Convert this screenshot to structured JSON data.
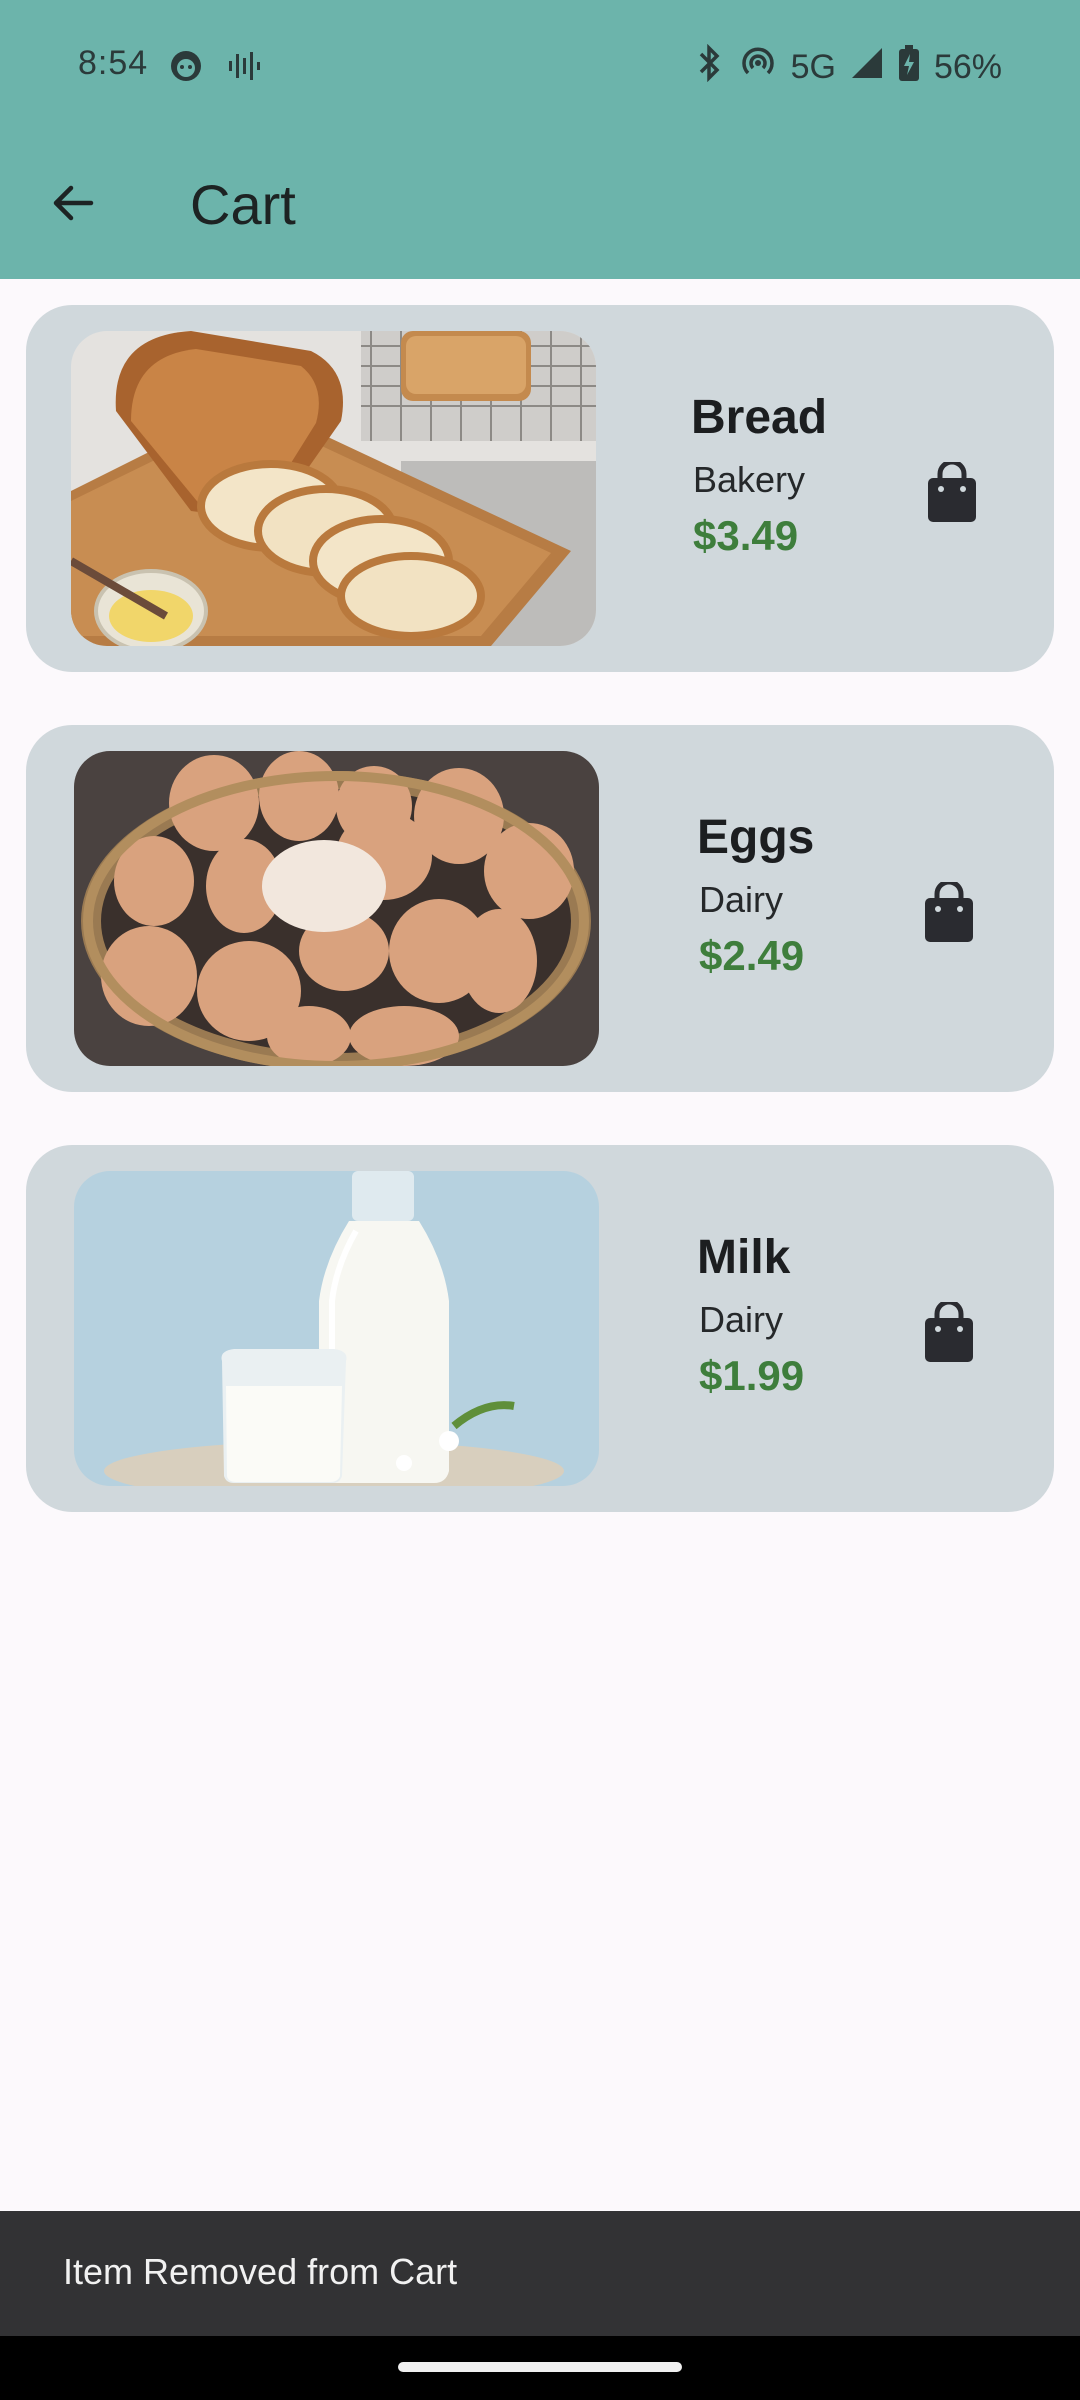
{
  "status_bar": {
    "time": "8:54",
    "network": "5G",
    "battery": "56%",
    "icons": [
      "face-icon",
      "voice-icon",
      "bluetooth-icon",
      "hotspot-icon",
      "signal-icon",
      "battery-icon"
    ]
  },
  "toolbar": {
    "title": "Cart",
    "back_icon": "arrow-left-icon"
  },
  "items": [
    {
      "name": "Bread",
      "category": "Bakery",
      "price": "$3.49",
      "image": "bread-photo",
      "action_icon": "shopping-bag-icon"
    },
    {
      "name": "Eggs",
      "category": "Dairy",
      "price": "$2.49",
      "image": "eggs-photo",
      "action_icon": "shopping-bag-icon"
    },
    {
      "name": "Milk",
      "category": "Dairy",
      "price": "$1.99",
      "image": "milk-photo",
      "action_icon": "shopping-bag-icon"
    }
  ],
  "snackbar": {
    "message": "Item Removed from Cart"
  },
  "colors": {
    "app_bar": "#6cb4ab",
    "card": "#d0d8dc",
    "price": "#3e7e3c",
    "background": "#fcf9fc"
  }
}
